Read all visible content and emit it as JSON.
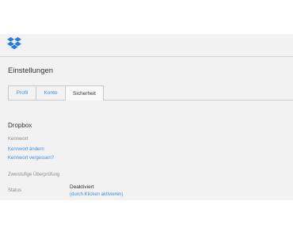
{
  "page": {
    "title": "Einstellungen"
  },
  "tabs": [
    {
      "label": "Profil"
    },
    {
      "label": "Konto"
    },
    {
      "label": "Sicherheit",
      "active": true
    }
  ],
  "security": {
    "section_title": "Dropbox",
    "password": {
      "label": "Kennwort",
      "change_link": "Kennwort ändern",
      "forgot_link": "Kennwort vergessen?"
    },
    "two_step": {
      "label": "Zweistufige Überprüfung",
      "status_label": "Status",
      "status_value": "Deaktiviert",
      "enable_link": "(durch Klicken aktivieren)"
    }
  },
  "colors": {
    "brand": "#1f7fe0",
    "link": "#3d8fe0",
    "background": "#f2f2f2"
  },
  "icons": {
    "logo": "dropbox-logo-icon"
  }
}
